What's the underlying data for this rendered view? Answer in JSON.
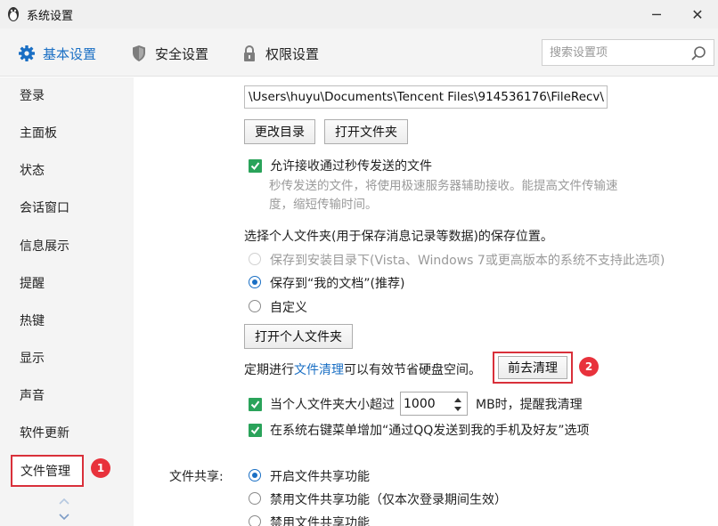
{
  "window": {
    "title": "系统设置",
    "minimize_glyph": "─",
    "close_glyph": "✕"
  },
  "tabs": [
    {
      "label": "基本设置",
      "icon": "gear-icon",
      "active": true
    },
    {
      "label": "安全设置",
      "icon": "shield-icon",
      "active": false
    },
    {
      "label": "权限设置",
      "icon": "lock-icon",
      "active": false
    }
  ],
  "search": {
    "placeholder": "搜索设置项",
    "value": ""
  },
  "sidebar": {
    "items": [
      "登录",
      "主面板",
      "状态",
      "会话窗口",
      "信息展示",
      "提醒",
      "热键",
      "显示",
      "声音",
      "软件更新",
      "文件管理"
    ],
    "active_index": 10,
    "active_badge": "1"
  },
  "main": {
    "path": "\\Users\\huyu\\Documents\\Tencent Files\\914536176\\FileRecv\\",
    "change_dir_button": "更改目录",
    "open_folder_button": "打开文件夹",
    "allow_receive_label": "允许接收通过秒传发送的文件",
    "allow_receive_desc_line1": "秒传发送的文件，将使用极速服务器辅助接收。能提高文件传输速",
    "allow_receive_desc_line2": "度，缩短传输时间。",
    "personal_folder_heading": "选择个人文件夹(用于保存消息记录等数据)的保存位置。",
    "radio_install_dir": "保存到安装目录下(Vista、Windows 7或更高版本的系统不支持此选项)",
    "radio_my_docs": "保存到“我的文档”(推荐)",
    "radio_custom": "自定义",
    "open_personal_folder_button": "打开个人文件夹",
    "cleanup_prefix": "定期进行",
    "cleanup_link": "文件清理",
    "cleanup_suffix": "可以有效节省硬盘空间。",
    "cleanup_button": "前去清理",
    "cleanup_badge": "2",
    "size_limit_prefix": "当个人文件夹大小超过",
    "size_limit_value": "1000",
    "size_limit_suffix": "MB时，提醒我清理",
    "context_menu_label": "在系统右键菜单增加“通过QQ发送到我的手机及好友”选项",
    "file_share_label": "文件共享:",
    "share_enable": "开启文件共享功能",
    "share_disable_session": "禁用文件共享功能（仅本次登录期间生效）",
    "share_disable": "禁用文件共享功能"
  },
  "colors": {
    "accent": "#1a6fc4",
    "check_green": "#2aa35a",
    "highlight_red": "#d9303a"
  }
}
